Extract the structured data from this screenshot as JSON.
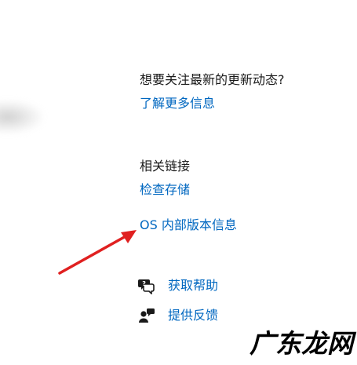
{
  "whats_new": {
    "heading": "想要关注最新的更新动态?",
    "learn_more": "了解更多信息"
  },
  "related_links": {
    "heading": "相关链接",
    "check_storage": "检查存储",
    "os_build_info": "OS 内部版本信息"
  },
  "support": {
    "get_help": "获取帮助",
    "give_feedback": "提供反馈",
    "get_help_icon": "chat-help-icon",
    "give_feedback_icon": "feedback-person-icon"
  },
  "annotation": {
    "arrow_color": "#e02020"
  },
  "watermark": {
    "text": "广东龙网"
  },
  "colors": {
    "link": "#0067c0",
    "text": "#1a1a1a",
    "background": "#ffffff"
  }
}
